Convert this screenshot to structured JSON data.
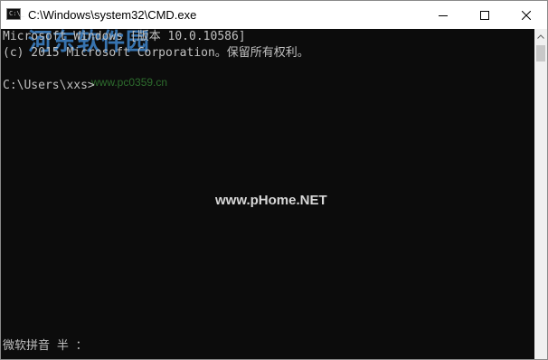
{
  "window": {
    "title": "C:\\Windows\\system32\\CMD.exe",
    "icon": "cmd-console-icon",
    "controls": {
      "minimize_icon": "minimize-icon",
      "maximize_icon": "maximize-icon",
      "close_icon": "close-icon"
    }
  },
  "console": {
    "lines": [
      "Microsoft Windows [版本 10.0.10586]",
      "(c) 2015 Microsoft Corporation。保留所有权利。",
      "C:\\Users\\xxs>"
    ],
    "ime_status": "微软拼音 半 ：",
    "colors": {
      "background": "#0c0c0c",
      "text": "#c0c0c0"
    }
  },
  "watermarks": {
    "logo_text": "河东软件园",
    "small_url": "www.pc0359.cn",
    "center_text": "www.pHome.NET"
  }
}
